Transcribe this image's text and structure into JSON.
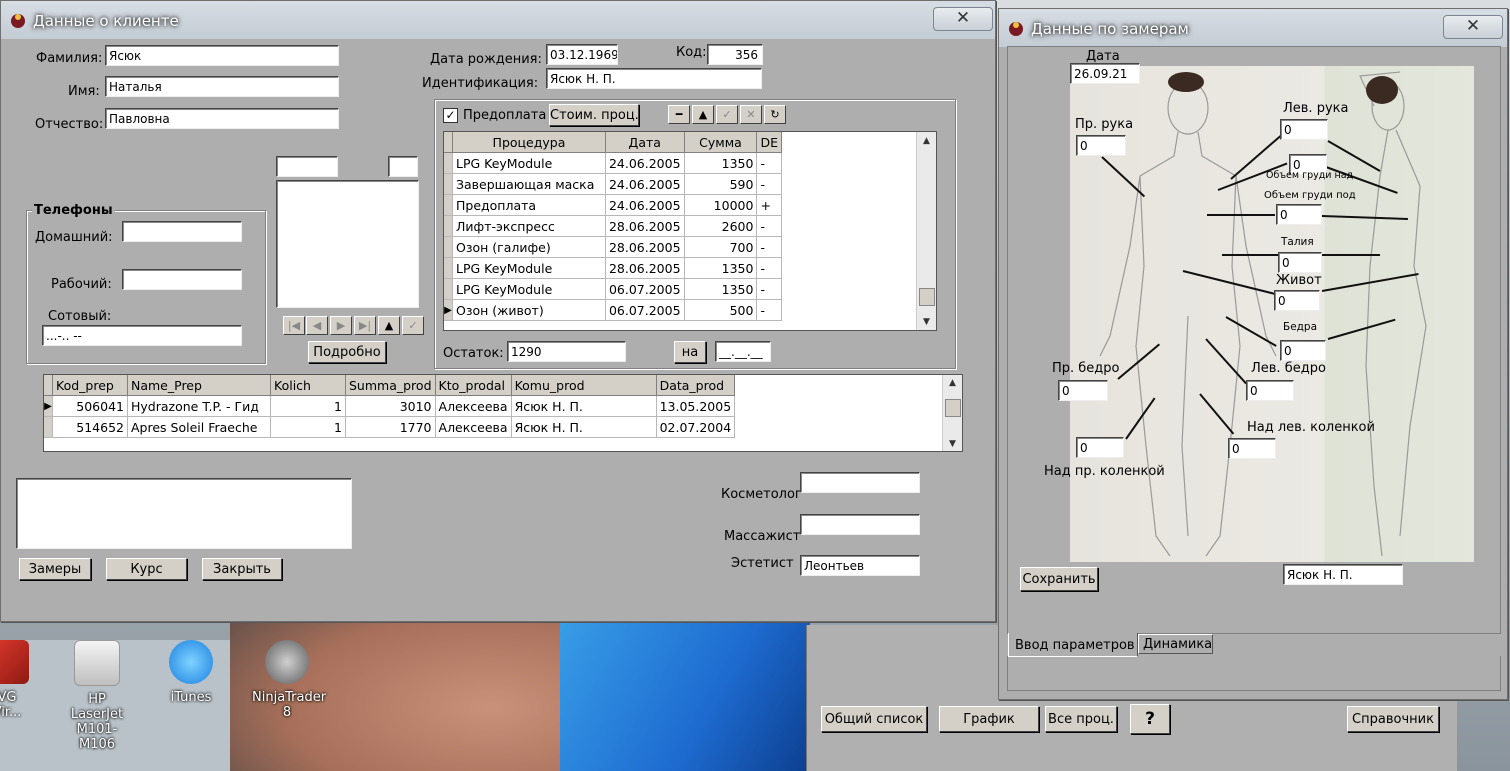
{
  "desktop": {
    "icons": [
      {
        "label_line1": "VG",
        "label_line2": "Vir..."
      },
      {
        "label_line1": "HP LaserJet",
        "label_line2": "M101-M106"
      },
      {
        "label_line1": "iTunes",
        "label_line2": ""
      },
      {
        "label_line1": "NinjaTrader 8",
        "label_line2": ""
      }
    ]
  },
  "client_window": {
    "title": "Данные о клиенте",
    "close_label": "✕",
    "surname_label": "Фамилия:",
    "surname": "Ясюк",
    "name_label": "Имя:",
    "name": "Наталья",
    "patronymic_label": "Отчество:",
    "patronymic": "Павловна",
    "birth_label": "Дата рождения:",
    "birth": "03.12.1969",
    "code_label": "Код:",
    "code": "356",
    "ident_label": "Идентификация:",
    "ident": "Ясюк Н. П.",
    "phones": {
      "title": "Телефоны",
      "home_label": "Домашний:",
      "home": "",
      "work_label": "Рабочий:",
      "work": "",
      "mobile_label": "Сотовый:",
      "mobile": "...-.. --"
    },
    "detail_button": "Подробно",
    "prepay_label": "Предоплата",
    "prepay_checked": true,
    "cost_button": "Стоим. проц.",
    "proc_table": {
      "headers": [
        "Процедура",
        "Дата",
        "Сумма",
        "DE"
      ],
      "rows": [
        [
          "LPG KeyModule",
          "24.06.2005",
          "1350",
          "-"
        ],
        [
          "Завершающая маска",
          "24.06.2005",
          "590",
          "-"
        ],
        [
          "Предоплата",
          "24.06.2005",
          "10000",
          "+"
        ],
        [
          "Лифт-экспресс",
          "28.06.2005",
          "2600",
          "-"
        ],
        [
          "Озон (галифе)",
          "28.06.2005",
          "700",
          "-"
        ],
        [
          "LPG KeyModule",
          "28.06.2005",
          "1350",
          "-"
        ],
        [
          "LPG KeyModule",
          "06.07.2005",
          "1350",
          "-"
        ],
        [
          "Озон (живот)",
          "06.07.2005",
          "500",
          "-"
        ]
      ]
    },
    "balance_label": "Остаток:",
    "balance": "1290",
    "na_button": "на",
    "na_date": "__.__.__",
    "prod_table": {
      "headers": [
        "Kod_prep",
        "Name_Prep",
        "Kolich",
        "Summa_prod",
        "Kto_prodal",
        "Komu_prod",
        "Data_prod"
      ],
      "rows": [
        [
          "506041",
          "Hydrazone T.P. - Гид",
          "1",
          "3010",
          "Алексеева",
          "Ясюк Н. П.",
          "13.05.2005"
        ],
        [
          "514652",
          "Apres Soleil Fraeche",
          "1",
          "1770",
          "Алексеева",
          "Ясюк Н. П.",
          "02.07.2004"
        ]
      ]
    },
    "cosmetologist_label": "Косметолог",
    "cosmetologist": "",
    "masseur_label": "Массажист",
    "masseur": "",
    "esthetician_label": "Эстетист",
    "esthetician": "Леонтьев",
    "buttons": {
      "measures": "Замеры",
      "course": "Курс",
      "close": "Закрыть"
    }
  },
  "measure_window": {
    "title": "Данные по замерам",
    "close_label": "✕",
    "date_label": "Дата",
    "date": "26.09.21",
    "fields": {
      "right_arm_label": "Пр. рука",
      "right_arm": "0",
      "left_arm_label": "Лев. рука",
      "left_arm": "0",
      "chest_over_label": "Объем груди над",
      "chest_over": "0",
      "chest_under_label": "Объем груди под",
      "chest_under": "0",
      "waist_label": "Талия",
      "waist": "0",
      "belly_label": "Живот",
      "belly": "0",
      "hips_label": "Бедра",
      "hips": "0",
      "right_thigh_label": "Пр. бедро",
      "right_thigh": "0",
      "left_thigh_label": "Лев. бедро",
      "left_thigh": "0",
      "left_knee_label": "Над лев. коленкой",
      "left_knee": "0",
      "right_knee_label": "Над пр. коленкой",
      "right_knee": "0"
    },
    "save_button": "Сохранить",
    "client_name": "Ясюк Н. П.",
    "tabs": [
      "Ввод параметров",
      "Динамика"
    ]
  },
  "bottom_bar": {
    "buttons": [
      "Общий список",
      "График",
      "Все проц.",
      "?",
      "Справочник"
    ]
  }
}
